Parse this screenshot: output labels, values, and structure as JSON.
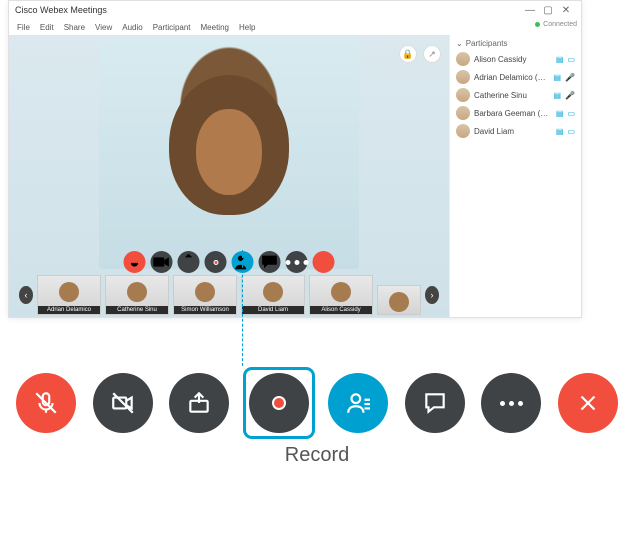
{
  "window": {
    "title": "Cisco Webex Meetings",
    "menus": [
      "File",
      "Edit",
      "Share",
      "View",
      "Audio",
      "Participant",
      "Meeting",
      "Help"
    ],
    "connection_status": "Connected"
  },
  "presenter": {
    "name": "Catherine Sinu"
  },
  "controls_small": {
    "mute": "mute-icon",
    "video": "video-icon",
    "share": "share-icon",
    "record": "record-icon",
    "participants": "participants-icon",
    "chat": "chat-icon",
    "more": "more-icon",
    "leave": "leave-icon"
  },
  "thumbnails": [
    {
      "name": "Adrian Delamico"
    },
    {
      "name": "Catherine Sinu"
    },
    {
      "name": "Simon Williamson"
    },
    {
      "name": "David Liam"
    },
    {
      "name": "Alison Cassidy"
    }
  ],
  "participants_panel": {
    "title": "Participants",
    "list": [
      {
        "name": "Alison Cassidy",
        "mic": "blue",
        "cam": "blue"
      },
      {
        "name": "Adrian Delamico (Host)",
        "mic": "blue",
        "cam": "red"
      },
      {
        "name": "Catherine Sinu",
        "mic": "blue",
        "cam": "red"
      },
      {
        "name": "Barbara Geeman (Me)",
        "mic": "blue",
        "cam": "blue"
      },
      {
        "name": "David Liam",
        "mic": "blue",
        "cam": "blue"
      }
    ]
  },
  "callout_label": "Record",
  "big_controls": [
    "mute",
    "video",
    "share",
    "record",
    "participants",
    "chat",
    "more",
    "leave"
  ]
}
